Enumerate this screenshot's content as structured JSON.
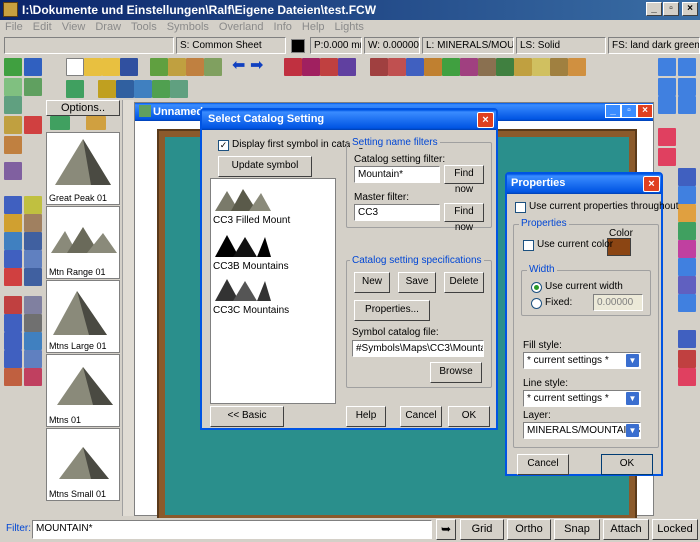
{
  "window": {
    "title": "I:\\Dokumente und Einstellungen\\Ralf\\Eigene Dateien\\test.FCW"
  },
  "menu": [
    "File",
    "Edit",
    "View",
    "Draw",
    "Tools",
    "Symbols",
    "Overland",
    "Info",
    "Help",
    "Lights"
  ],
  "status": {
    "sheet": "S: Common Sheet",
    "pen": "P:0.000 mm",
    "width": "W: 0.00000",
    "layer": "L: MINERALS/MOUNT",
    "linestyle": "LS: Solid",
    "fillstyle": "FS: land dark green Bitr"
  },
  "symbols_panel": {
    "options_label": "Options..",
    "items": [
      "Great Peak 01",
      "Mtn Range 01",
      "Mtns Large 01",
      "Mtns 01",
      "Mtns Small 01"
    ]
  },
  "drawing": {
    "title": "Unnamed v"
  },
  "catalog_dialog": {
    "title": "Select Catalog Setting",
    "display_first_symbol": "Display first symbol in catalog",
    "update_button": "Update symbol display",
    "list_items": [
      "CC3 Filled Mount",
      "CC3B Mountains",
      "CC3C Mountains"
    ],
    "filters_group": "Setting name filters",
    "catalog_filter_label": "Catalog setting filter:",
    "catalog_filter_value": "Mountain*",
    "find_now": "Find now",
    "master_filter_label": "Master filter:",
    "master_filter_value": "CC3",
    "specs_group": "Catalog setting specifications",
    "new_button": "New",
    "save_button": "Save",
    "delete_button": "Delete",
    "properties_button": "Properties...",
    "symbol_file_label": "Symbol catalog file:",
    "symbol_file_value": "#Symbols\\Maps\\CC3\\Mountains.F",
    "browse_button": "Browse",
    "basic_button": "<< Basic",
    "help_button": "Help",
    "cancel_button": "Cancel",
    "ok_button": "OK"
  },
  "properties_dialog": {
    "title": "Properties",
    "use_current_throughout": "Use current properties throughout",
    "properties_group": "Properties",
    "color_label": "Color",
    "use_current_color": "Use current color",
    "width_group": "Width",
    "use_current_width": "Use current width",
    "fixed_label": "Fixed:",
    "fixed_value": "0.00000",
    "fill_style_label": "Fill style:",
    "fill_style_value": "* current settings *",
    "line_style_label": "Line style:",
    "line_style_value": "* current settings *",
    "layer_label": "Layer:",
    "layer_value": "MINERALS/MOUNTAINS",
    "cancel_button": "Cancel",
    "ok_button": "OK"
  },
  "bottom_bar": {
    "filter_label": "Filter:",
    "filter_value": "MOUNTAIN*",
    "grid": "Grid",
    "ortho": "Ortho",
    "snap": "Snap",
    "attach": "Attach",
    "locked": "Locked"
  },
  "colors": {
    "titlebar": "#0a246a",
    "xp_blue": "#0054e3",
    "map_fill": "#2a8f8c",
    "map_border": "#8b5a2b",
    "swatch": "#8b4513"
  }
}
